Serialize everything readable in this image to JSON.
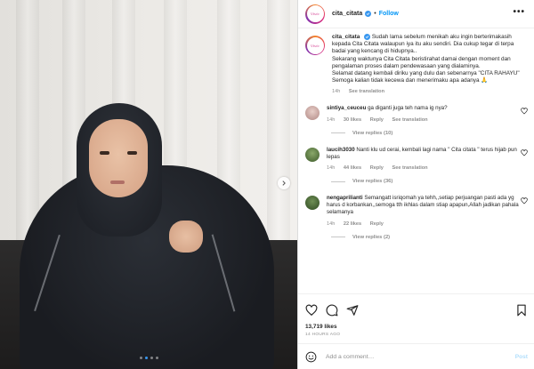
{
  "post": {
    "author": "cita_citata",
    "follow_label": "Follow",
    "separator": "•",
    "more_label": "•••",
    "avatar_text": "Vivic",
    "caption_author": "cita_citata",
    "caption_paragraphs": [
      "Sudah lama sebelum menikah aku ingin berterimakasih kepada Cita Citata walaupun iya itu aku sendiri. Dia cukup tegar di terpa badai yang kencang di hidupnya..",
      "Sekarang waktunya Cita Citata beristirahat damai dengan moment dan pengalaman proses dalam pendewasaan yang dialaminya.",
      "Selamat datang kembali diriku yang dulu dan sebenarnya \"CITA RAHAYU\"",
      "Semoga kalian tidak kecewa dan menerimaku apa adanya 🙏"
    ],
    "caption_time": "14h",
    "caption_translate": "See translation",
    "likes": "13,719 likes",
    "timestamp": "14 HOURS AGO"
  },
  "comments": [
    {
      "user": "sintiya_ceuceu",
      "text": "ga diganti juga teh nama ig nya?",
      "time": "14h",
      "likes": "30 likes",
      "reply": "Reply",
      "translate": "See translation",
      "view_replies": "View replies (10)",
      "avatar_color": "#c9a9a6"
    },
    {
      "user": "laucih3030",
      "text": "Nanti klu ud cerai, kembali lagi nama \" Cita citata \" terus hijab pun lepas",
      "time": "14h",
      "likes": "44 likes",
      "reply": "Reply",
      "translate": "See translation",
      "view_replies": "View replies (36)",
      "avatar_color": "#4d6b3a"
    },
    {
      "user": "nengaprilianti",
      "text": "Semangatt isriqomah ya tehh,,setiap perjuangan pasti ada yg harus d korbankan,,semoga tth ikhlas dalam stiap apapun,Allah jadikan pahala selamanya",
      "time": "14h",
      "likes": "22 likes",
      "reply": "Reply",
      "translate": "",
      "view_replies": "View replies (2)",
      "avatar_color": "#3b5a2c"
    }
  ],
  "add_comment": {
    "placeholder": "Add a comment…",
    "post_label": "Post"
  },
  "colors": {
    "accent": "#0095f6",
    "verified": "#3897f0",
    "muted": "#8e8e8e",
    "post_disabled": "#b2dffc"
  },
  "icons": [
    "verified-badge-icon",
    "more-options-icon",
    "chevron-right-icon",
    "heart-icon",
    "comment-icon",
    "share-icon",
    "bookmark-icon",
    "emoji-icon"
  ],
  "carousel": {
    "count": 4,
    "active_index": 1
  }
}
